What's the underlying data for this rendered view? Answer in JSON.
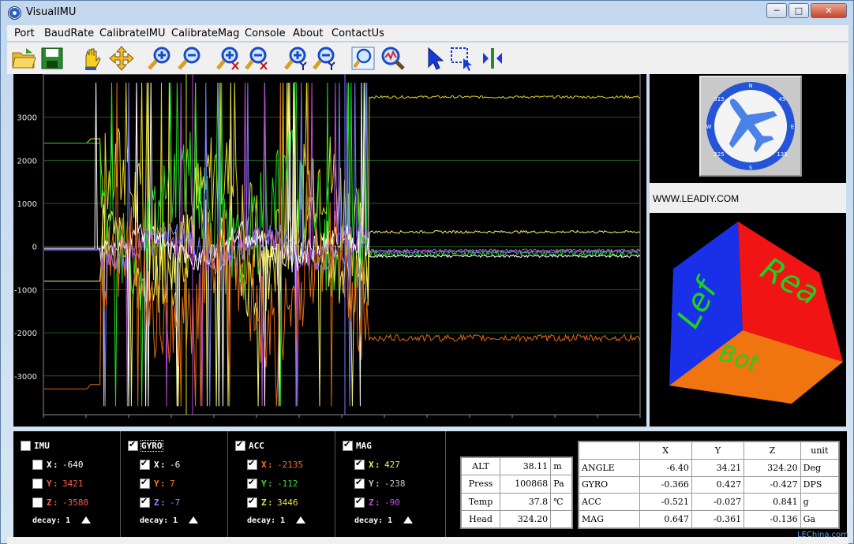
{
  "window": {
    "title": "VisualIMU",
    "minimize": "─",
    "maximize": "□",
    "close": "✕"
  },
  "menu": [
    "Port",
    "BaudRate",
    "CalibrateIMU",
    "CalibrateMag",
    "Console",
    "About",
    "ContactUs"
  ],
  "toolbar_icons": [
    "open-folder-icon",
    "save-icon",
    "pan-hand-icon",
    "move-icon",
    "zoom-in-icon",
    "zoom-out-icon",
    "zoom-in-x-icon",
    "zoom-out-x-icon",
    "zoom-in-y-icon",
    "zoom-out-y-icon",
    "zoom-fit-icon",
    "zoom-auto-icon",
    "pointer-icon",
    "select-region-icon",
    "split-view-icon"
  ],
  "chart_data": {
    "type": "line",
    "yticks": [
      "3000",
      "2000",
      "1000",
      "0",
      "-1000",
      "-2000",
      "-3000"
    ],
    "ylim": [
      -3900,
      4000
    ],
    "grid": true,
    "series": [
      {
        "color": "#e0d72a",
        "steady": 3470
      },
      {
        "color": "#f4f46a",
        "steady": 340
      },
      {
        "color": "#22dd22",
        "steady": -150
      },
      {
        "color": "#7a7aff",
        "steady": -120
      },
      {
        "color": "#c04bd8",
        "steady": -90
      },
      {
        "color": "#ffffff",
        "steady": -220
      },
      {
        "color": "#e06a16",
        "steady": -2120
      }
    ]
  },
  "side": {
    "url": "WWW.LEADIY.COM",
    "compass_labels": [
      "N",
      "45",
      "E",
      "135",
      "S",
      "225",
      "W",
      "315"
    ],
    "cube_faces": [
      "Lef",
      "Rea",
      "Bot"
    ]
  },
  "groups": [
    {
      "name": "IMU",
      "checked": false,
      "rows": [
        {
          "axis": "X",
          "value": "-640",
          "color": "#ffffff",
          "checked": false
        },
        {
          "axis": "Y",
          "value": "3421",
          "color": "#ff5a4a",
          "checked": false
        },
        {
          "axis": "Z",
          "value": "-3580",
          "color": "#ff5a4a",
          "checked": false
        }
      ],
      "decay": "decay: 1"
    },
    {
      "name": "GYRO",
      "checked": true,
      "rows": [
        {
          "axis": "X",
          "value": "-6",
          "color": "#ffffff",
          "checked": true
        },
        {
          "axis": "Y",
          "value": "7",
          "color": "#ff7a2a",
          "checked": true
        },
        {
          "axis": "Z",
          "value": "-7",
          "color": "#8a8aff",
          "checked": true
        }
      ],
      "decay": "decay: 1"
    },
    {
      "name": "ACC",
      "checked": true,
      "rows": [
        {
          "axis": "X",
          "value": "-2135",
          "color": "#ff6a2a",
          "checked": true
        },
        {
          "axis": "Y",
          "value": "-112",
          "color": "#32e032",
          "checked": true
        },
        {
          "axis": "Z",
          "value": "3446",
          "color": "#e8e23a",
          "checked": true
        }
      ],
      "decay": "decay: 1"
    },
    {
      "name": "MAG",
      "checked": true,
      "rows": [
        {
          "axis": "X",
          "value": "427",
          "color": "#f0f050",
          "checked": true
        },
        {
          "axis": "Y",
          "value": "-238",
          "color": "#c8c8c8",
          "checked": true
        },
        {
          "axis": "Z",
          "value": "-90",
          "color": "#c050e0",
          "checked": true
        }
      ],
      "decay": "decay: 1"
    }
  ],
  "env": [
    {
      "label": "ALT",
      "value": "38.11",
      "unit": "m"
    },
    {
      "label": "Press",
      "value": "100868",
      "unit": "Pa"
    },
    {
      "label": "Temp",
      "value": "37.8",
      "unit": "℃"
    },
    {
      "label": "Head",
      "value": "324.20",
      "unit": ""
    }
  ],
  "table": {
    "headers": [
      "",
      "X",
      "Y",
      "Z",
      "unit"
    ],
    "rows": [
      [
        "ANGLE",
        "-6.40",
        "34.21",
        "324.20",
        "Deg"
      ],
      [
        "GYRO",
        "-0.366",
        "0.427",
        "-0.427",
        "DPS"
      ],
      [
        "ACC",
        "-0.521",
        "-0.027",
        "0.841",
        "g"
      ],
      [
        "MAG",
        "0.647",
        "-0.361",
        "-0.136",
        "Ga"
      ]
    ]
  },
  "watermark": "LEChina.com"
}
